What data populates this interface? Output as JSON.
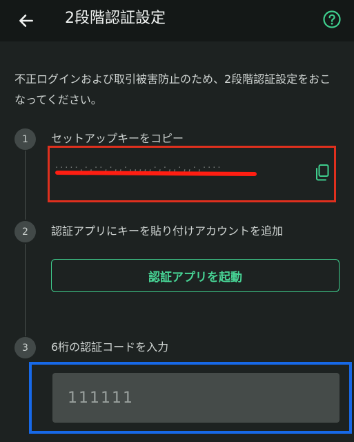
{
  "header": {
    "title": "2段階認証設定",
    "back_icon": "arrow-left-icon",
    "help_icon": "question-circle-icon"
  },
  "description": "不正ログインおよび取引被害防止のため、2段階認証設定をおこなってください。",
  "steps": [
    {
      "number": "1",
      "label": "セットアップキーをコピー",
      "copy_icon": "copy-icon"
    },
    {
      "number": "2",
      "label": "認証アプリにキーを貼り付けアカウントを追加",
      "button_label": "認証アプリを起動"
    },
    {
      "number": "3",
      "label": "6桁の認証コードを入力",
      "input_placeholder": "111111"
    }
  ],
  "colors": {
    "accent": "#3fcf8e",
    "background": "#1d2221",
    "header_bg": "#141817",
    "redact_box": "#e0301e",
    "highlight_box": "#1769e8"
  }
}
